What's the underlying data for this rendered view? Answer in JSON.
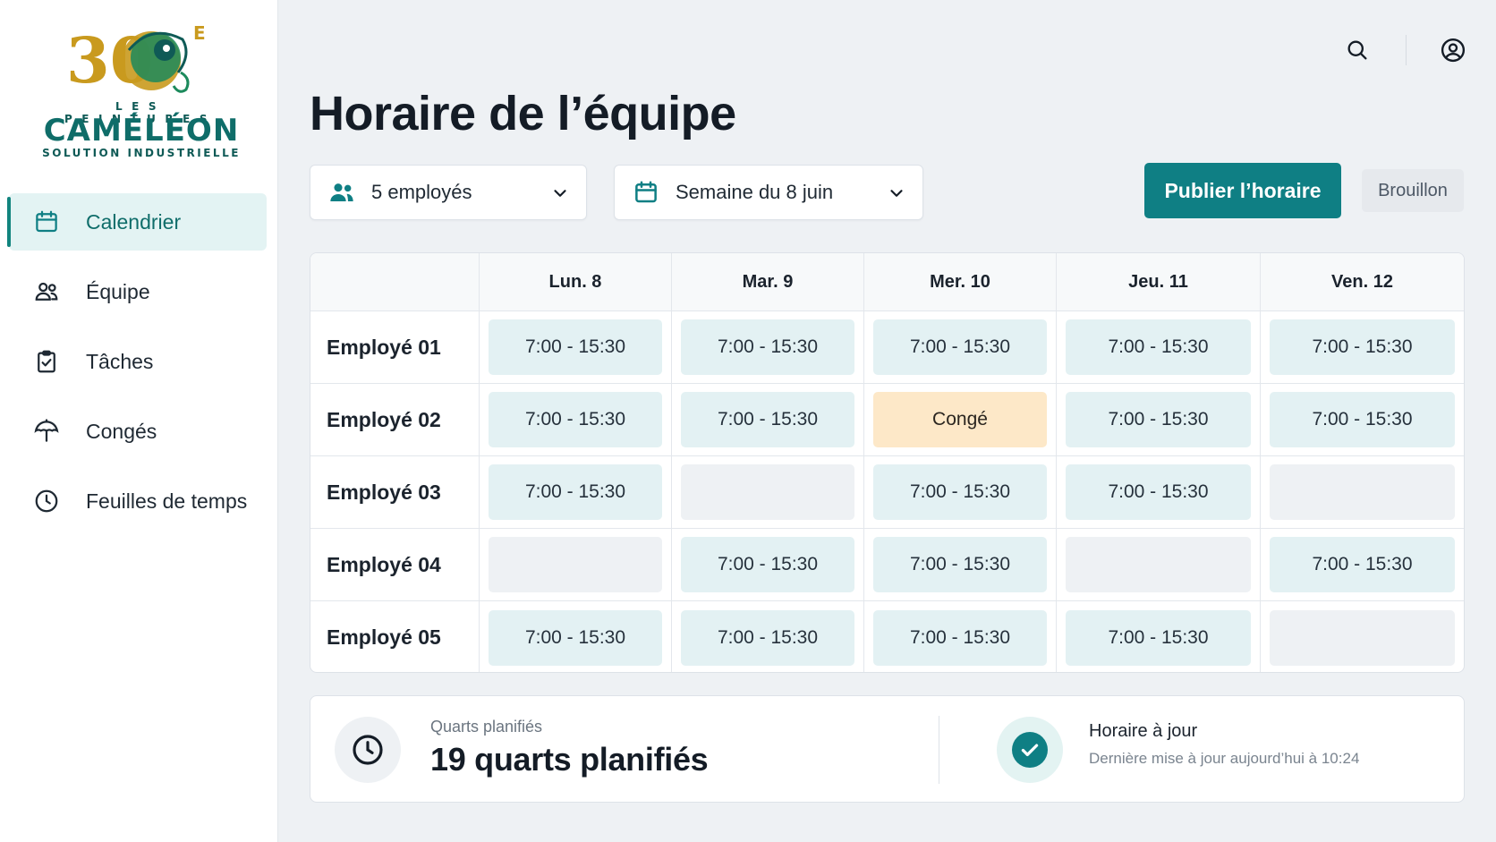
{
  "brand": {
    "logo_anniversary": "30",
    "logo_superscript": "E",
    "logo_top": "LES PEINTURES",
    "logo_name": "CAMÉLÉON",
    "logo_sub": "SOLUTION INDUSTRIELLE",
    "colors": {
      "primary": "#0f7f84",
      "gold": "#c99a1e",
      "green": "#0f6d69"
    }
  },
  "sidebar": {
    "items": [
      {
        "label": "Calendrier",
        "icon": "calendar-icon",
        "active": true
      },
      {
        "label": "Équipe",
        "icon": "team-icon",
        "active": false
      },
      {
        "label": "Tâches",
        "icon": "clipboard-check-icon",
        "active": false
      },
      {
        "label": "Congés",
        "icon": "umbrella-icon",
        "active": false
      },
      {
        "label": "Feuilles de temps",
        "icon": "clock-icon",
        "active": false
      }
    ]
  },
  "header": {
    "title": "Horaire de l’équipe",
    "icons": [
      "search-icon",
      "account-icon"
    ]
  },
  "filters": {
    "employees": "5 employés",
    "week": "Semaine du 8 juin"
  },
  "actions": {
    "publish": "Publier l’horaire",
    "status_badge": "Brouillon"
  },
  "schedule": {
    "days": [
      "Lun. 8",
      "Mar. 9",
      "Mer. 10",
      "Jeu. 11",
      "Ven. 12"
    ],
    "rows": [
      {
        "employee": "Employé 01",
        "shifts": [
          "7:00 - 15:30",
          "7:00 - 15:30",
          "7:00 - 15:30",
          "7:00 - 15:30",
          "7:00 - 15:30"
        ],
        "types": [
          "work",
          "work",
          "work",
          "work",
          "work"
        ]
      },
      {
        "employee": "Employé 02",
        "shifts": [
          "7:00 - 15:30",
          "7:00 - 15:30",
          "Congé",
          "7:00 - 15:30",
          "7:00 - 15:30"
        ],
        "types": [
          "work",
          "work",
          "leave",
          "work",
          "work"
        ]
      },
      {
        "employee": "Employé 03",
        "shifts": [
          "7:00 - 15:30",
          "",
          "7:00 - 15:30",
          "7:00 - 15:30",
          ""
        ],
        "types": [
          "work",
          "empty",
          "work",
          "work",
          "empty"
        ]
      },
      {
        "employee": "Employé 04",
        "shifts": [
          "",
          "7:00 - 15:30",
          "7:00 - 15:30",
          "",
          "7:00 - 15:30"
        ],
        "types": [
          "empty",
          "work",
          "work",
          "empty",
          "work"
        ]
      },
      {
        "employee": "Employé 05",
        "shifts": [
          "7:00 - 15:30",
          "7:00 - 15:30",
          "7:00 - 15:30",
          "7:00 - 15:30",
          ""
        ],
        "types": [
          "work",
          "work",
          "work",
          "work",
          "empty"
        ]
      }
    ]
  },
  "summary": {
    "label": "Quarts planifiés",
    "value": "19 quarts planifiés",
    "status_title": "Horaire à jour",
    "status_sub": "Dernière mise à jour aujourd’hui à 10:24"
  }
}
